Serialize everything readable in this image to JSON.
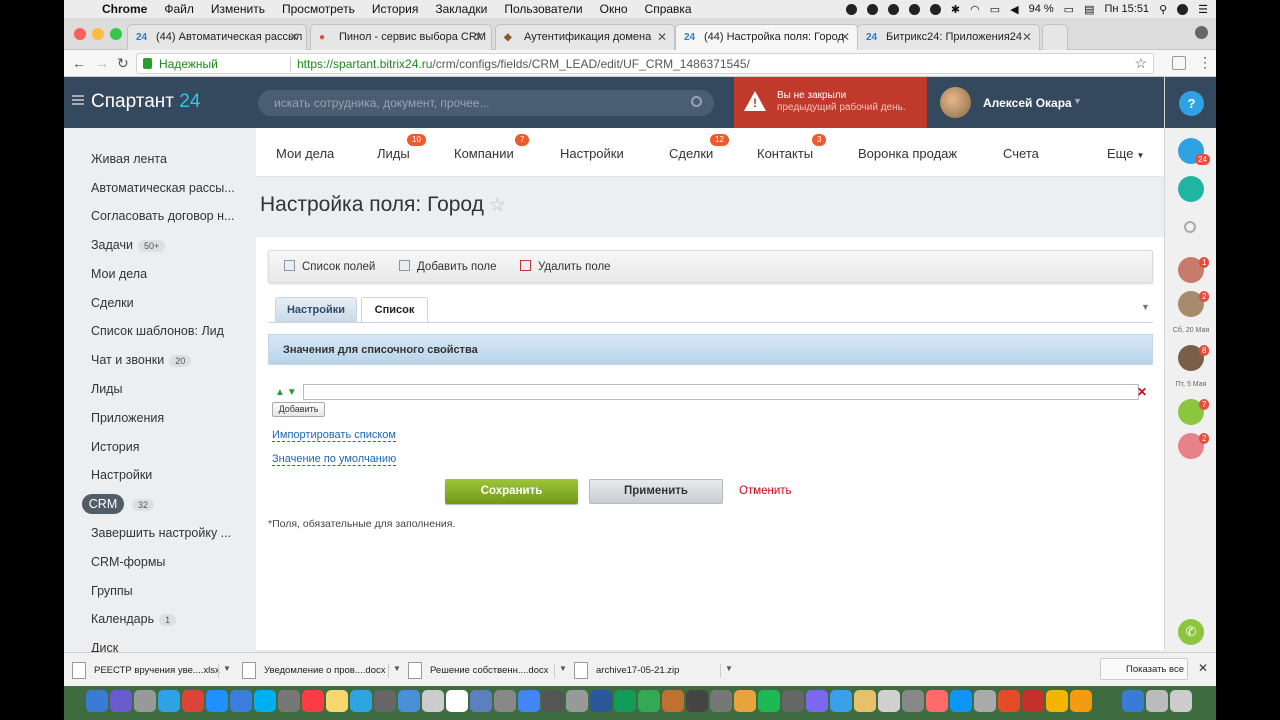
{
  "menubar": {
    "items": [
      "Chrome",
      "Файл",
      "Изменить",
      "Просмотреть",
      "История",
      "Закладки",
      "Пользователи",
      "Окно",
      "Справка"
    ],
    "battery": "94 %",
    "time": "Пн 15:51"
  },
  "browser": {
    "tabs": [
      {
        "icon": "24",
        "title": "(44) Автоматическая рассыл"
      },
      {
        "icon": "●",
        "title": "Пинол - сервис выбора CRM"
      },
      {
        "icon": "◆",
        "title": "Аутентификация домена"
      },
      {
        "icon": "24",
        "title": "(44) Настройка поля: Город"
      },
      {
        "icon": "24",
        "title": "Битрикс24: Приложения24"
      }
    ],
    "secure_label": "Надежный",
    "url_host": "https://spartant.bitrix24.ru",
    "url_path": "/crm/configs/fields/CRM_LEAD/edit/UF_CRM_1486371545/"
  },
  "header": {
    "logo_text": "Спартант",
    "logo_num": "24",
    "search_placeholder": "искать сотрудника, документ, прочее...",
    "alert_line1": "Вы не закрыли",
    "alert_line2": "предыдущий рабочий день.",
    "user_name": "Алексей Окара",
    "help": "?"
  },
  "right_panel": {
    "notif_count": "24",
    "badges": [
      "1",
      "2",
      "8",
      "7",
      "2"
    ],
    "date1": "Сб, 20 Мая",
    "date2": "Пт, 5 Мая"
  },
  "sidebar": {
    "items": [
      {
        "label": "Живая лента"
      },
      {
        "label": "Автоматическая рассы..."
      },
      {
        "label": "Согласовать договор н..."
      },
      {
        "label": "Задачи",
        "count": "50+"
      },
      {
        "label": "Мои дела"
      },
      {
        "label": "Сделки"
      },
      {
        "label": "Список шаблонов: Лид"
      },
      {
        "label": "Чат и звонки",
        "count": "20"
      },
      {
        "label": "Лиды"
      },
      {
        "label": "Приложения"
      },
      {
        "label": "История"
      },
      {
        "label": "Настройки"
      },
      {
        "label": "CRM",
        "count": "32"
      },
      {
        "label": "Завершить настройку ..."
      },
      {
        "label": "CRM-формы"
      },
      {
        "label": "Группы"
      },
      {
        "label": "Календарь",
        "count": "1"
      },
      {
        "label": "Диск"
      }
    ]
  },
  "topmenu": {
    "items": [
      {
        "label": "Мои дела"
      },
      {
        "label": "Лиды",
        "badge": "10"
      },
      {
        "label": "Компании",
        "badge": "7"
      },
      {
        "label": "Настройки"
      },
      {
        "label": "Сделки",
        "badge": "12"
      },
      {
        "label": "Контакты",
        "badge": "3"
      },
      {
        "label": "Воронка продаж"
      },
      {
        "label": "Счета"
      },
      {
        "label": "Еще"
      }
    ]
  },
  "page": {
    "title": "Настройка поля: Город",
    "toolbar": {
      "list": "Список полей",
      "add": "Добавить поле",
      "delete": "Удалить поле"
    },
    "tabs": {
      "settings": "Настройки",
      "list": "Список"
    },
    "section_title": "Значения для списочного свойства",
    "value_input": "",
    "add_button": "Добавить",
    "import_link": "Импортировать списком",
    "default_link": "Значение по умолчанию",
    "save": "Сохранить",
    "apply": "Применить",
    "cancel": "Отменить",
    "required_note": "*Поля, обязательные для заполнения."
  },
  "downloads": {
    "files": [
      "РЕЕСТР вручения уве....xlsx",
      "Уведомление о пров....docx",
      "Решение собственн....docx",
      "archive17-05-21.zip"
    ],
    "show_all": "Показать все"
  },
  "colors": {
    "accent": "#2fc6f6",
    "header": "#34495e",
    "alert": "#c0392b",
    "save": "#7ba624",
    "badge": "#f0592b"
  }
}
